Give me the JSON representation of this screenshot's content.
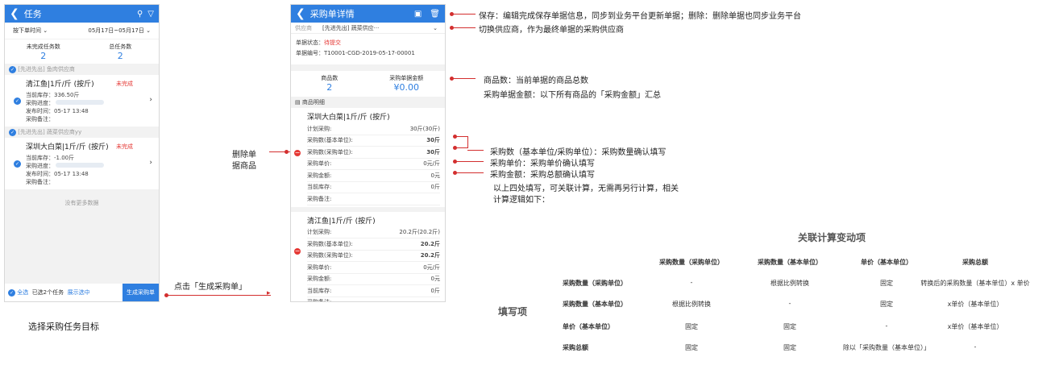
{
  "left": {
    "title": "任务",
    "sort_label": "按下单时间",
    "date_range": "05月17日~05月17日",
    "unfinished_label": "未完成任务数",
    "unfinished_count": "2",
    "total_label": "总任务数",
    "total_count": "2",
    "groups": [
      {
        "tag": "[先进先出] 鱼肉供应商",
        "name": "清江鱼|1斤/斤 (按斤)",
        "status": "未完成",
        "stock": "当前库存：336.50斤",
        "prog": "采购进度：",
        "time": "发布时间：05-17 13:48",
        "note": "采购备注："
      },
      {
        "tag": "[先进先出] 蔬菜供应商yy",
        "name": "深圳大白菜|1斤/斤 (按斤)",
        "status": "未完成",
        "stock": "当前库存：-1.00斤",
        "prog": "采购进度：",
        "time": "发布时间：05-17 13:48",
        "note": "采购备注："
      }
    ],
    "nomore": "没有更多数据",
    "select_all": "全选",
    "selected": "已选2个任务",
    "show_selected": "展示选中",
    "generate_btn": "生成采购单"
  },
  "caption_left": "选择采购任务目标",
  "arrow_label": "点击「生成采购单」",
  "delete_label_1": "删除单",
  "delete_label_2": "据商品",
  "right": {
    "title": "采购单详情",
    "supplier_label": "供应商",
    "supplier_value": "[先进先出] 蔬菜供应···",
    "status_label": "单据状态：",
    "status_value": "待提交",
    "no_label": "单据编号：",
    "no_value": "T10001-CGD-2019-05-17-00001",
    "count_label": "商品数",
    "count_value": "2",
    "amount_label": "采购单据金额",
    "amount_value": "¥0.00",
    "detail_label": "商品明细",
    "items": [
      {
        "name": "深圳大白菜|1斤/斤 (按斤)",
        "rows": [
          [
            "计划采购:",
            "30斤(30斤)"
          ],
          [
            "采购数(基本单位):",
            "30斤"
          ],
          [
            "采购数(采购单位):",
            "30斤"
          ],
          [
            "采购单价:",
            "0元/斤"
          ],
          [
            "采购金额:",
            "0元"
          ],
          [
            "当前库存:",
            "0斤"
          ],
          [
            "采购备注:",
            ""
          ]
        ]
      },
      {
        "name": "清江鱼|1斤/斤 (按斤)",
        "rows": [
          [
            "计划采购:",
            "20.2斤(20.2斤)"
          ],
          [
            "采购数(基本单位):",
            "20.2斤"
          ],
          [
            "采购数(采购单位):",
            "20.2斤"
          ],
          [
            "采购单价:",
            "0元/斤"
          ],
          [
            "采购金额:",
            "0元"
          ],
          [
            "当前库存:",
            "0斤"
          ],
          [
            "采购备注:",
            ""
          ]
        ]
      }
    ]
  },
  "annotations": {
    "save": "保存：编辑完成保存单据信息，同步到业务平台更新单据；删除：删除单据也同步业务平台",
    "switch": "切换供应商，作为最终单据的采购供应商",
    "count": "商品数：当前单据的商品总数",
    "amount": "采购单据金额：以下所有商品的「采购金额」汇总",
    "qty": "采购数（基本单位/采购单位）：采购数量确认填写",
    "price": "采购单价：采购单价确认填写",
    "total": "采购金额：采购总额确认填写",
    "note1": "以上四处填写，可关联计算，无需再另行计算，相关",
    "note2": "计算逻辑如下："
  },
  "table": {
    "title": "关联计算变动项",
    "side_label": "填写项",
    "headers": [
      "采购数量（采购单位）",
      "采购数量（基本单位）",
      "单价（基本单位）",
      "采购总额"
    ],
    "rows": [
      {
        "label": "采购数量（采购单位）",
        "cells": [
          "-",
          "根据比例转换",
          "固定",
          "转换后的采购数量（基本单位）x 单价"
        ]
      },
      {
        "label": "采购数量（基本单位）",
        "cells": [
          "根据比例转换",
          "-",
          "固定",
          "x单价（基本单位）"
        ]
      },
      {
        "label": "单价（基本单位）",
        "cells": [
          "固定",
          "固定",
          "-",
          "x单价（基本单位）"
        ]
      },
      {
        "label": "采购总额",
        "cells": [
          "固定",
          "固定",
          "除以「采购数量（基本单位）」",
          "-"
        ]
      }
    ]
  }
}
